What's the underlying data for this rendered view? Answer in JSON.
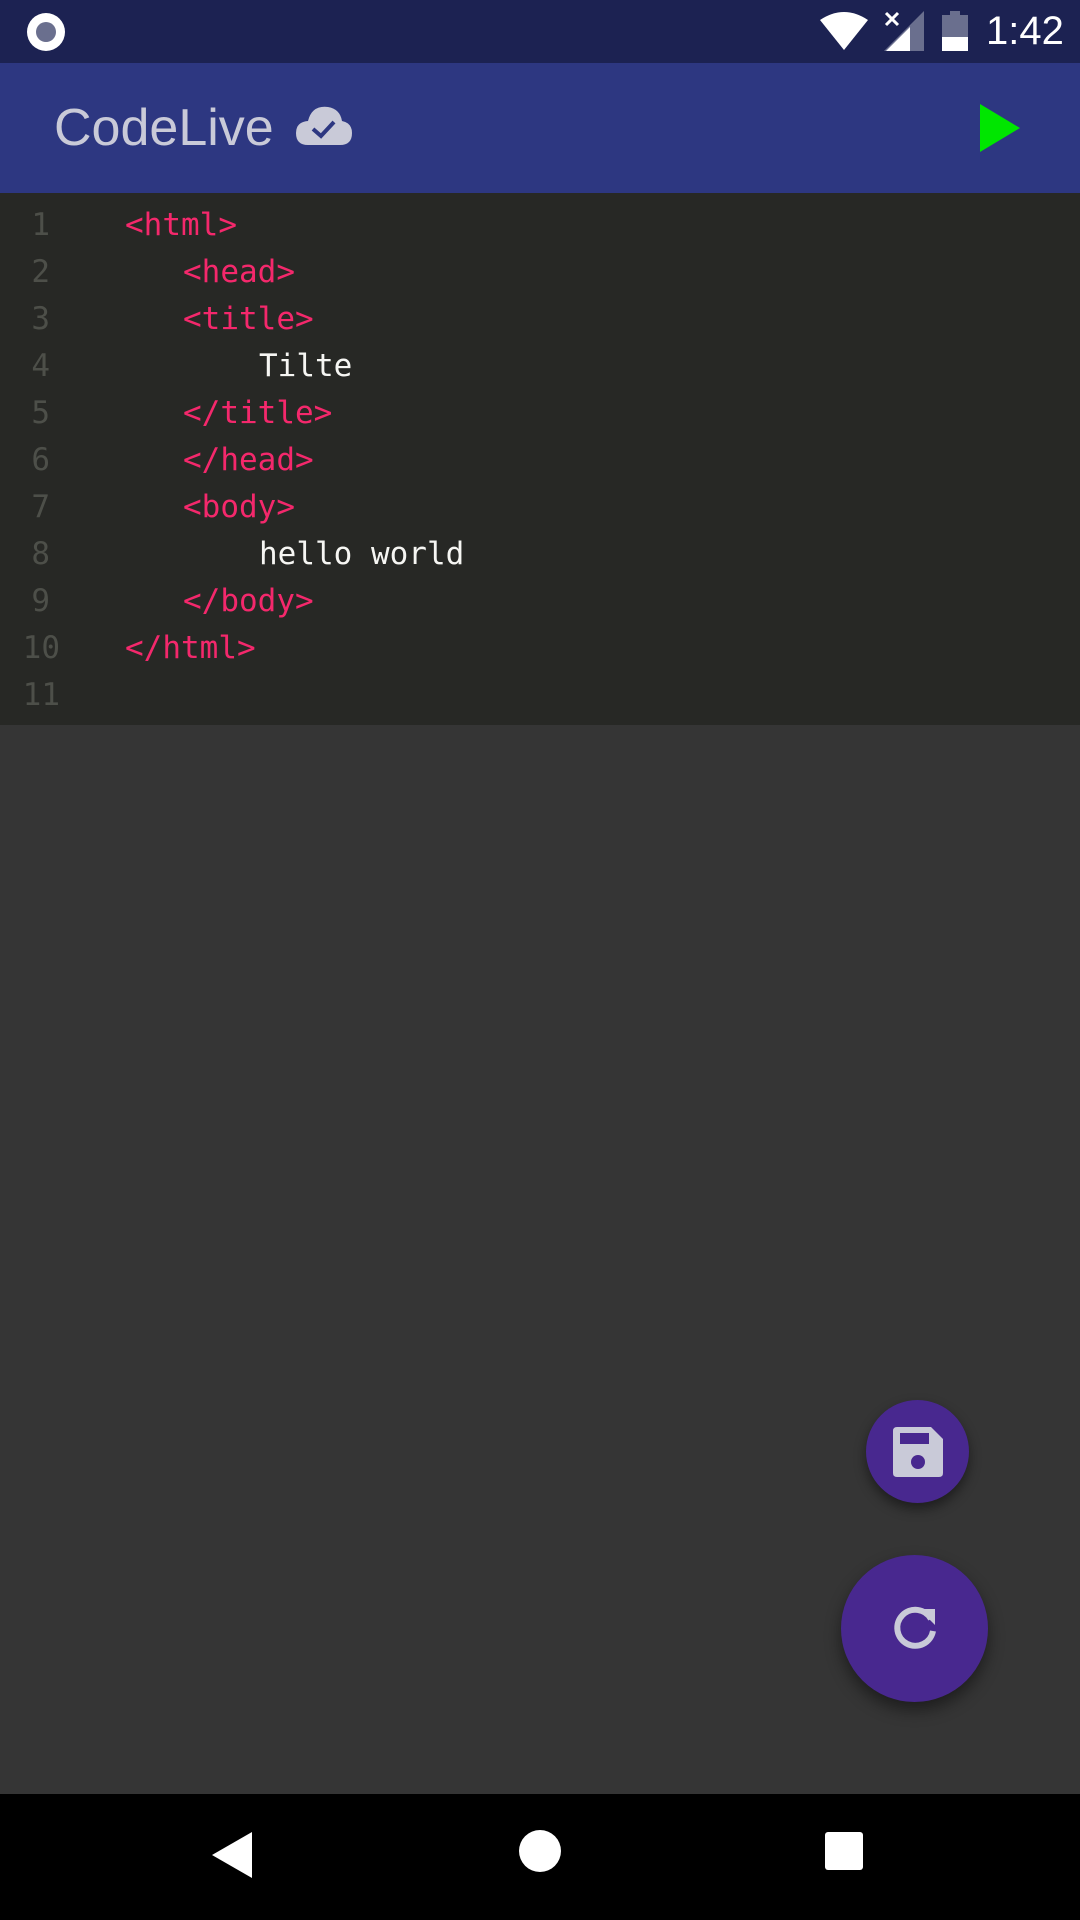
{
  "status_bar": {
    "time": "1:42",
    "icons": [
      "record-icon",
      "wifi-icon",
      "signal-icon",
      "battery-icon"
    ]
  },
  "app_bar": {
    "title": "CodeLive",
    "sync_icon": "cloud-check-icon",
    "run_icon": "play-icon",
    "run_color": "#00e600"
  },
  "editor": {
    "lines": [
      {
        "number": "1",
        "code": "<html>"
      },
      {
        "number": "2",
        "code": "<head>"
      },
      {
        "number": "3",
        "code": "<title>"
      },
      {
        "number": "4",
        "code": "Tilte"
      },
      {
        "number": "5",
        "code": "</title>"
      },
      {
        "number": "6",
        "code": "</head>"
      },
      {
        "number": "7",
        "code": "<body>"
      },
      {
        "number": "8",
        "code": "hello world"
      },
      {
        "number": "9",
        "code": "</body>"
      },
      {
        "number": "10",
        "code": "</html>"
      },
      {
        "number": "11",
        "code": ""
      }
    ],
    "tag_color": "#f4286c",
    "text_color": "#f6f6f3",
    "background": "#272825"
  },
  "fabs": {
    "save_icon": "save-icon",
    "refresh_icon": "refresh-icon",
    "color": "#48288f"
  },
  "nav_bar": {
    "icons": [
      "back-icon",
      "home-icon",
      "recents-icon"
    ]
  }
}
